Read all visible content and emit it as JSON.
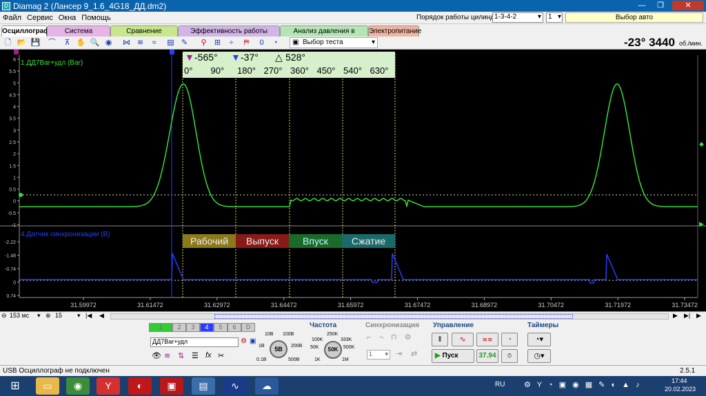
{
  "window": {
    "title": "Diamag 2 (Лансер 9_1.6_4G18_ДД.dm2)"
  },
  "menu": [
    "Файл",
    "Сервис",
    "Окна",
    "Помощь"
  ],
  "header": {
    "cyl_order_label": "Порядок работы цилиндров",
    "cyl_order_value": "1-3-4-2",
    "cyl_num": "1",
    "auto_select": "Выбор авто"
  },
  "tabs": [
    "Осциллограф",
    "Система зажигания",
    "Сравнение цилиндров",
    "Эффективность работы цилиндров",
    "Анализ давления в цилиндре",
    "Электропитание"
  ],
  "toolbar": {
    "test_select": "Выбор теста",
    "readout": "-23° 3440",
    "readout_unit": "об./мин."
  },
  "markers": {
    "m1": "-565°",
    "m2": "-37°",
    "delta": "528°"
  },
  "degrees": [
    "0°",
    "90°",
    "180°",
    "270°",
    "360°",
    "450°",
    "540°",
    "630°"
  ],
  "phases": [
    {
      "label": "Рабочий",
      "color": "#8a7a1a"
    },
    {
      "label": "Выпуск",
      "color": "#8a1a1a"
    },
    {
      "label": "Впуск",
      "color": "#1a6a2a"
    },
    {
      "label": "Сжатие",
      "color": "#1a6a6a"
    }
  ],
  "channels": {
    "ch1": "1.ДД7Bar+удл (Bar)",
    "ch4": "4.Датчик синхронизации (В)"
  },
  "ch1_ticks": [
    "6",
    "5.5",
    "5",
    "4.5",
    "4",
    "3.5",
    "3",
    "2.5",
    "2",
    "1.5",
    "1",
    "0.5",
    "0",
    "-0.5",
    "-1"
  ],
  "ch4_ticks": [
    "-2.22",
    "-1.48",
    "-0.74",
    "0",
    "0.74"
  ],
  "time_ticks": [
    "31.59972",
    "31.61472",
    "31.62972",
    "31.64472",
    "31.65972",
    "31.67472",
    "31.68972",
    "31.70472",
    "31.71972",
    "31.73472"
  ],
  "nav": {
    "timebase": "153 мс",
    "count": "15"
  },
  "control": {
    "channel_tabs": [
      "1",
      "2",
      "3",
      "4",
      "5",
      "6",
      "D"
    ],
    "channel_name": "ДД7Bar+удл",
    "volt_labels": [
      "10В",
      "100В",
      "1В",
      "200В",
      "0.1В",
      "500В"
    ],
    "volt_value": "5В",
    "freq_title": "Частота",
    "freq_labels": [
      "250K",
      "100K",
      "333K",
      "50K",
      "500K",
      "1K",
      "1M"
    ],
    "freq_value": "50K",
    "sync_title": "Синхронизация",
    "sync_value": "1",
    "control_title": "Управление",
    "start": "Пуск",
    "rpm_value": "37.94",
    "timers_title": "Таймеры"
  },
  "status": {
    "left": "USB Осциллограф не подключен",
    "version": "2.5.1"
  },
  "tray": {
    "lang": "RU",
    "time": "17:44",
    "date": "20.02.2023"
  },
  "accent": {
    "green_trace": "#35e03a",
    "blue_trace": "#2a3cff",
    "title_blue": "#0a64ad"
  }
}
